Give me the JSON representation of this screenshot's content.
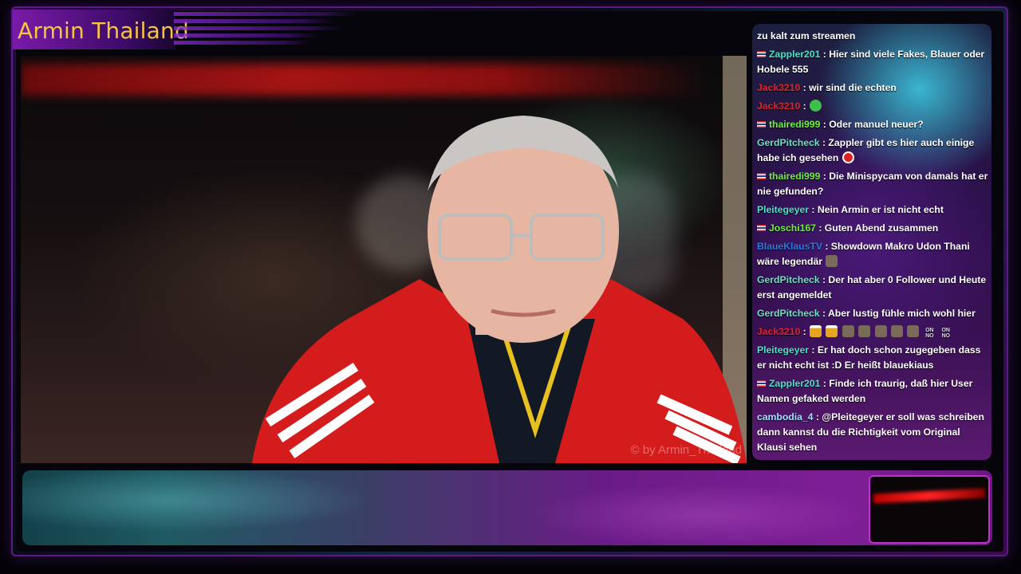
{
  "stream": {
    "title": "Armin Thailand",
    "watermark": "© by Armin_Thailand"
  },
  "chat": {
    "messages": [
      {
        "user": "",
        "color": "#ffffff",
        "flag": false,
        "text": "zu kalt zum streamen",
        "emotes": []
      },
      {
        "user": "Zappler201",
        "color": "#4fe0c8",
        "flag": true,
        "text": "Hier sind viele Fakes, Blauer oder Hobele 555",
        "emotes": []
      },
      {
        "user": "Jack3210",
        "color": "#e0242c",
        "flag": false,
        "text": "wir sind die echten",
        "emotes": []
      },
      {
        "user": "Jack3210",
        "color": "#e0242c",
        "flag": false,
        "text": "",
        "emotes": [
          "green"
        ]
      },
      {
        "user": "thairedi999",
        "color": "#6cf03a",
        "flag": true,
        "text": "Oder manuel neuer?",
        "emotes": []
      },
      {
        "user": "GerdPitcheck",
        "color": "#6ee0c0",
        "flag": false,
        "text": "Zappler gibt es hier auch einige habe ich gesehen",
        "emotes": [
          "redcircle"
        ]
      },
      {
        "user": "thairedi999",
        "color": "#6cf03a",
        "flag": true,
        "text": "Die Minispycam von damals hat er nie gefunden?",
        "emotes": []
      },
      {
        "user": "Pleitegeyer",
        "color": "#4fe0c8",
        "flag": false,
        "text": "Nein Armin er ist nicht echt",
        "emotes": []
      },
      {
        "user": "Joschi167",
        "color": "#6cf03a",
        "flag": true,
        "text": "Guten Abend zusammen",
        "emotes": []
      },
      {
        "user": "BlaueKlausTV",
        "color": "#2a7ae0",
        "flag": false,
        "text": "Showdown Makro Udon Thani wäre legendär",
        "emotes": [
          "face"
        ]
      },
      {
        "user": "GerdPitcheck",
        "color": "#6ee0c0",
        "flag": false,
        "text": "Der hat aber 0 Follower und Heute erst angemeldet",
        "emotes": []
      },
      {
        "user": "GerdPitcheck",
        "color": "#6ee0c0",
        "flag": false,
        "text": "Aber lustig fühle mich wohl hier",
        "emotes": []
      },
      {
        "user": "Jack3210",
        "color": "#e0242c",
        "flag": false,
        "text": "",
        "emotes": [
          "beer",
          "beer",
          "face",
          "face",
          "face",
          "face",
          "face",
          "onno",
          "onno"
        ]
      },
      {
        "user": "Pleitegeyer",
        "color": "#4fe0c8",
        "flag": false,
        "text": "Er hat doch schon zugegeben dass er nicht echt ist :D Er heißt blauekiaus",
        "emotes": []
      },
      {
        "user": "Zappler201",
        "color": "#4fe0c8",
        "flag": true,
        "text": "Finde ich traurig, daß hier User Namen gefaked werden",
        "emotes": []
      },
      {
        "user": "cambodia_4",
        "color": "#a0e0ff",
        "flag": false,
        "text": "@Pleitegeyer er soll was schreiben dann kannst du die Richtigkeit vom Original Klausi sehen",
        "emotes": []
      }
    ]
  },
  "colors": {
    "title": "#f6c63f",
    "accent": "#7a1aa8"
  }
}
